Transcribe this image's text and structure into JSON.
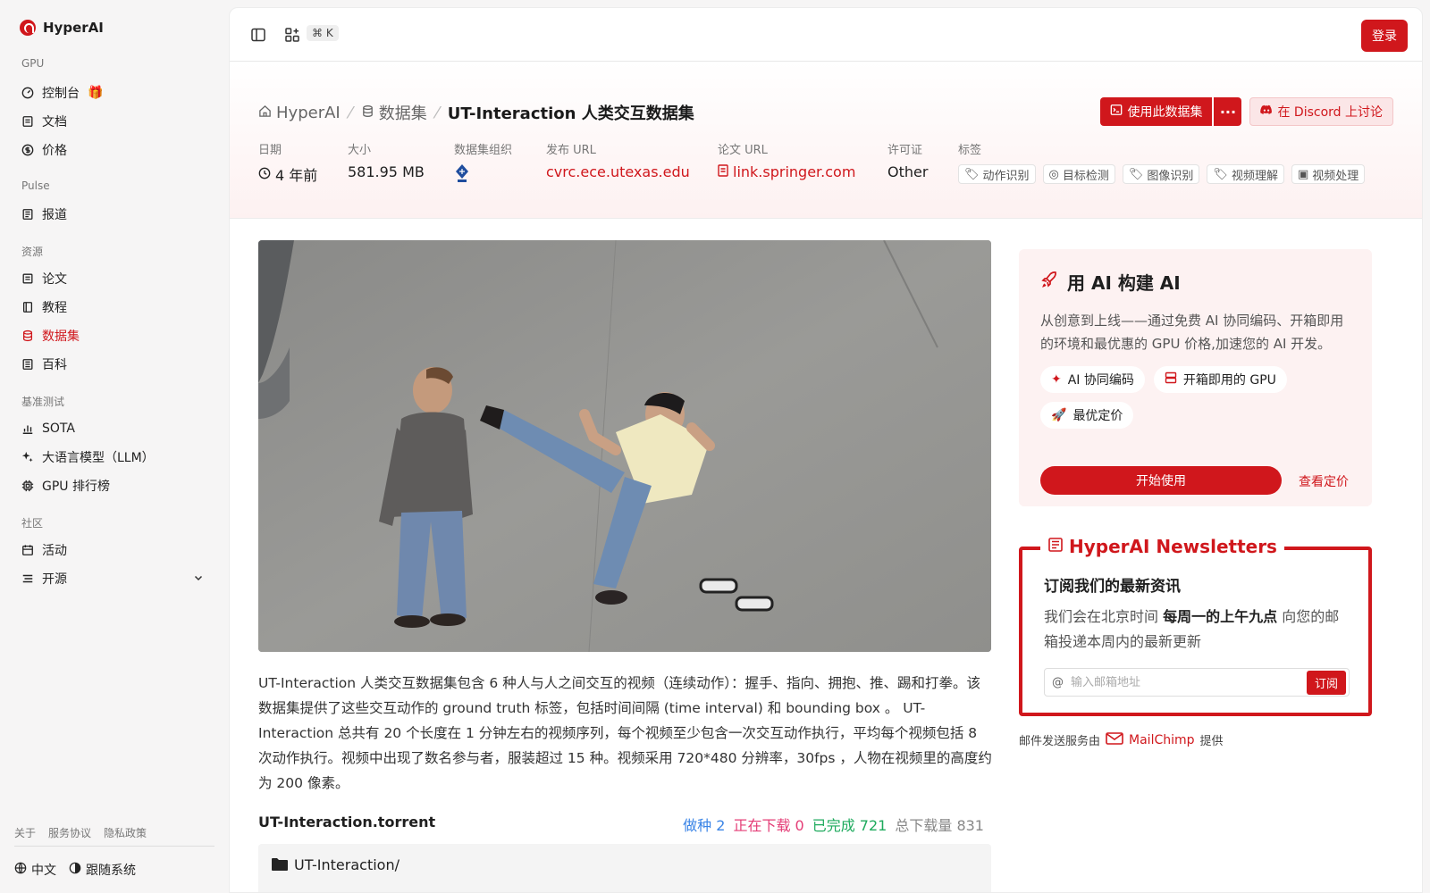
{
  "app": {
    "name": "HyperAI"
  },
  "sidebar": {
    "sections": [
      {
        "title": "GPU",
        "items": [
          {
            "label": "控制台"
          },
          {
            "label": "文档"
          },
          {
            "label": "价格"
          }
        ]
      },
      {
        "title": "Pulse",
        "items": [
          {
            "label": "报道"
          }
        ]
      },
      {
        "title": "资源",
        "items": [
          {
            "label": "论文"
          },
          {
            "label": "教程"
          },
          {
            "label": "数据集"
          },
          {
            "label": "百科"
          }
        ]
      },
      {
        "title": "基准测试",
        "items": [
          {
            "label": "SOTA"
          },
          {
            "label": "大语言模型（LLM）"
          },
          {
            "label": "GPU 排行榜"
          }
        ]
      },
      {
        "title": "社区",
        "items": [
          {
            "label": "活动"
          },
          {
            "label": "开源"
          }
        ]
      }
    ],
    "footer_links": [
      "关于",
      "服务协议",
      "隐私政策"
    ],
    "language": "中文",
    "theme": "跟随系统",
    "accent": "#d0171c"
  },
  "topbar": {
    "shortcut": "⌘ K",
    "login": "登录"
  },
  "header": {
    "breadcrumbs": [
      "HyperAI",
      "数据集",
      "UT-Interaction 人类交互数据集"
    ],
    "use_dataset": "使用此数据集",
    "discord": "在 Discord 上讨论",
    "meta": {
      "date_label": "日期",
      "date_value": "4 年前",
      "size_label": "大小",
      "size_value": "581.95 MB",
      "org_label": "数据集组织",
      "publish_label": "发布 URL",
      "publish_value": "cvrc.ece.utexas.edu",
      "paper_label": "论文 URL",
      "paper_value": "link.springer.com",
      "license_label": "许可证",
      "license_value": "Other",
      "tags_label": "标签",
      "tags": [
        "动作识别",
        "目标检测",
        "图像识别",
        "视频理解",
        "视频处理"
      ]
    }
  },
  "description": "UT-Interaction 人类交互数据集包含 6 种人与人之间交互的视频（连续动作）：握手、指向、拥抱、推、踢和打拳。该数据集提供了这些交互动作的 ground truth 标签，包括时间间隔 (time interval) 和 bounding box 。 UT-Interaction 总共有 20 个长度在 1 分钟左右的视频序列，每个视频至少包含一次交互动作执行，平均每个视频包括 8 次动作执行。视频中出现了数名参与者，服装超过 15 种。视频采用 720*480 分辨率，30fps ，人物在视频里的高度约为 200 像素。",
  "torrent": {
    "title": "UT-Interaction.torrent",
    "seeding": "做种 2",
    "downloading": "正在下载 0",
    "completed": "已完成 721",
    "total": "总下载量 831",
    "folder": "UT-Interaction/"
  },
  "ai_card": {
    "title": "用 AI 构建 AI",
    "text": "从创意到上线——通过免费 AI 协同编码、开箱即用的环境和最优惠的 GPU 价格,加速您的 AI 开发。",
    "pills": [
      "AI 协同编码",
      "开箱即用的 GPU",
      "最优定价"
    ],
    "start": "开始使用",
    "pricing": "查看定价"
  },
  "newsletter": {
    "title": "HyperAI Newsletters",
    "heading": "订阅我们的最新资讯",
    "text_before": "我们会在北京时间 ",
    "text_bold": "每周一的上午九点",
    "text_after": " 向您的邮箱投递本周内的最新更新",
    "placeholder": "输入邮箱地址",
    "subscribe": "订阅",
    "provider_prefix": "邮件发送服务由",
    "provider": "MailChimp",
    "provider_suffix": "提供"
  }
}
